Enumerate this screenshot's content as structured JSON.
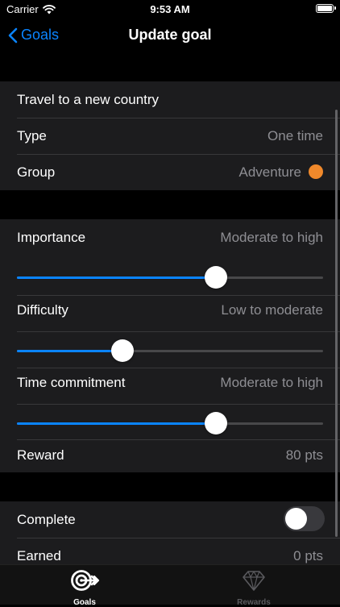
{
  "status_bar": {
    "carrier": "Carrier",
    "time": "9:53 AM"
  },
  "nav": {
    "back_label": "Goals",
    "title": "Update goal"
  },
  "goal": {
    "name": "Travel to a new country",
    "type_label": "Type",
    "type_value": "One time",
    "group_label": "Group",
    "group_value": "Adventure",
    "group_color": "#f0892b"
  },
  "attributes": {
    "importance_label": "Importance",
    "importance_value": "Moderate to high",
    "importance_level": 0.65,
    "difficulty_label": "Difficulty",
    "difficulty_value": "Low to moderate",
    "difficulty_level": 0.345,
    "time_label": "Time commitment",
    "time_value": "Moderate to high",
    "time_level": 0.65,
    "reward_label": "Reward",
    "reward_value": "80 pts"
  },
  "completion": {
    "complete_label": "Complete",
    "complete_on": false,
    "earned_label": "Earned",
    "earned_value": "0 pts"
  },
  "tab_bar": {
    "tabs": [
      {
        "label": "Goals",
        "active": true
      },
      {
        "label": "Rewards",
        "active": false
      }
    ]
  },
  "colors": {
    "accent": "#0a84ff",
    "inactive_tab": "#5a5a5e",
    "active_tab": "#ffffff"
  }
}
